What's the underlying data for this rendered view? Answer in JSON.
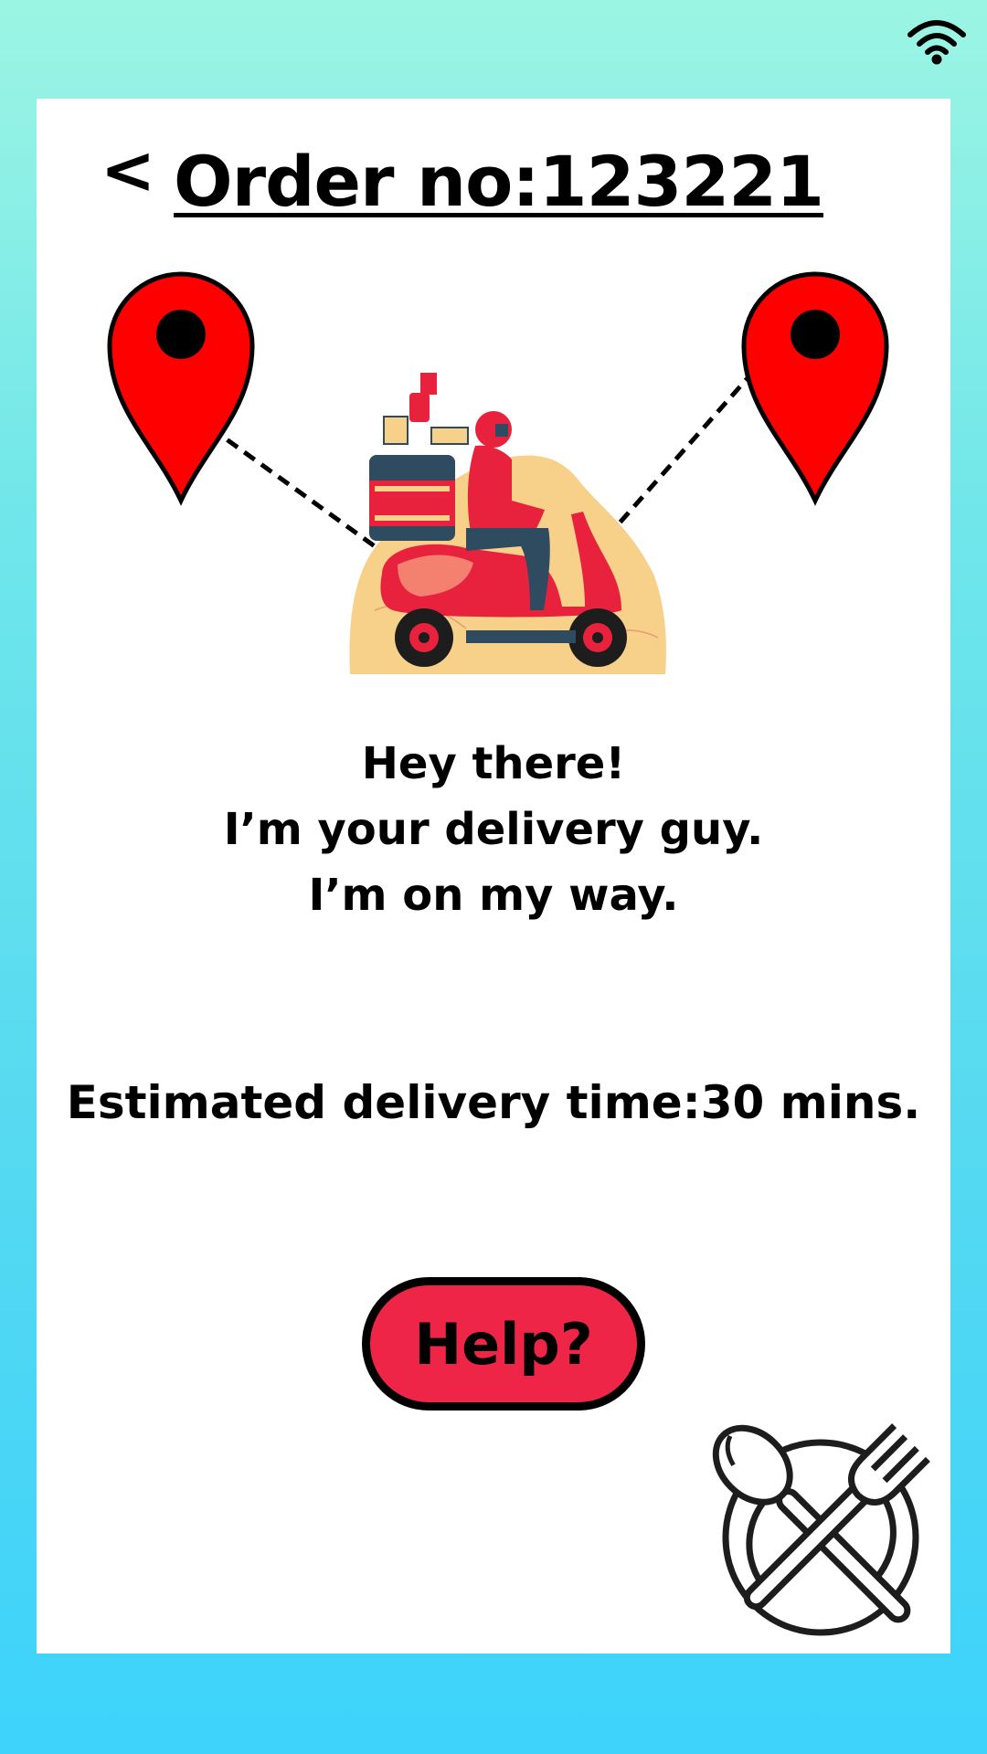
{
  "status_bar": {
    "wifi_icon": "wifi-icon"
  },
  "header": {
    "back_label": "<",
    "order_title": "Order no:123221"
  },
  "route": {
    "origin_icon": "map-pin-icon",
    "destination_icon": "map-pin-icon",
    "courier_image": "delivery-scooter-illustration"
  },
  "message": {
    "line1": "Hey there!",
    "line2": "I’m your delivery guy.",
    "line3": "I’m on my way."
  },
  "eta": {
    "text": "Estimated delivery time:30 mins."
  },
  "help_button": {
    "label": "Help?"
  },
  "footer": {
    "logo_icon": "plate-spoon-fork-icon"
  },
  "colors": {
    "accent": "#ef2548",
    "pin": "#ff0000",
    "background_top": "#9cf5e3",
    "background_bottom": "#3dd3fb",
    "card": "#ffffff"
  }
}
